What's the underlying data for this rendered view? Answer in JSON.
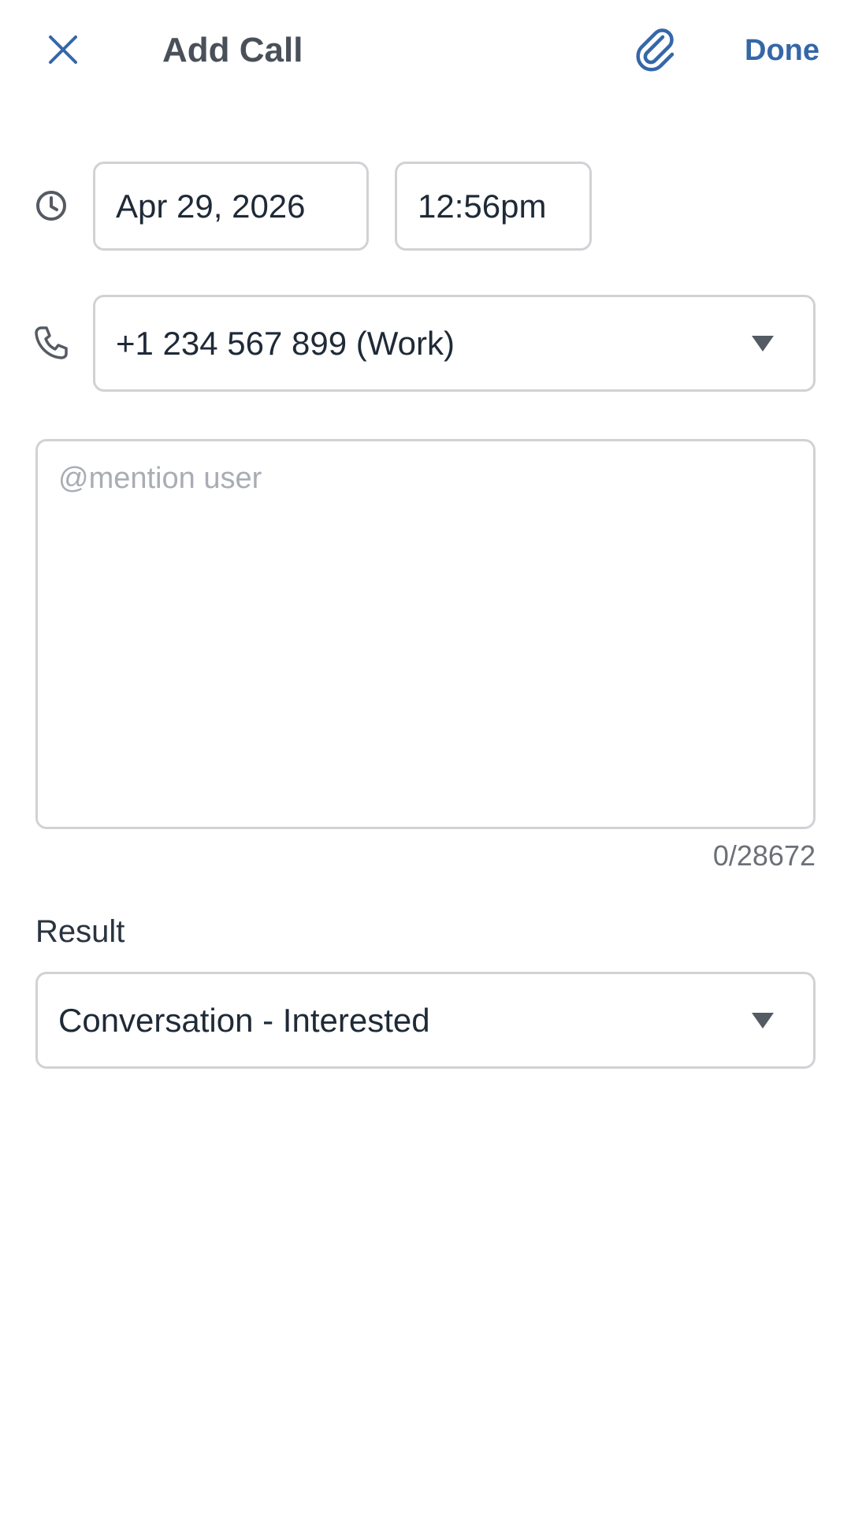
{
  "header": {
    "title": "Add Call",
    "done_label": "Done",
    "close_icon": "close-icon",
    "attach_icon": "paperclip-icon"
  },
  "datetime": {
    "date": "Apr 29, 2026",
    "time": "12:56pm",
    "icon": "clock-icon"
  },
  "phone": {
    "selected": "+1 234 567 899 (Work)",
    "icon": "phone-icon"
  },
  "notes": {
    "value": "",
    "placeholder": "@mention user",
    "counter": "0/28672"
  },
  "result": {
    "label": "Result",
    "selected": "Conversation - Interested"
  },
  "colors": {
    "accent": "#3567a8",
    "title": "#4a5059",
    "border": "#d0d2d5",
    "text": "#1f2a37"
  }
}
